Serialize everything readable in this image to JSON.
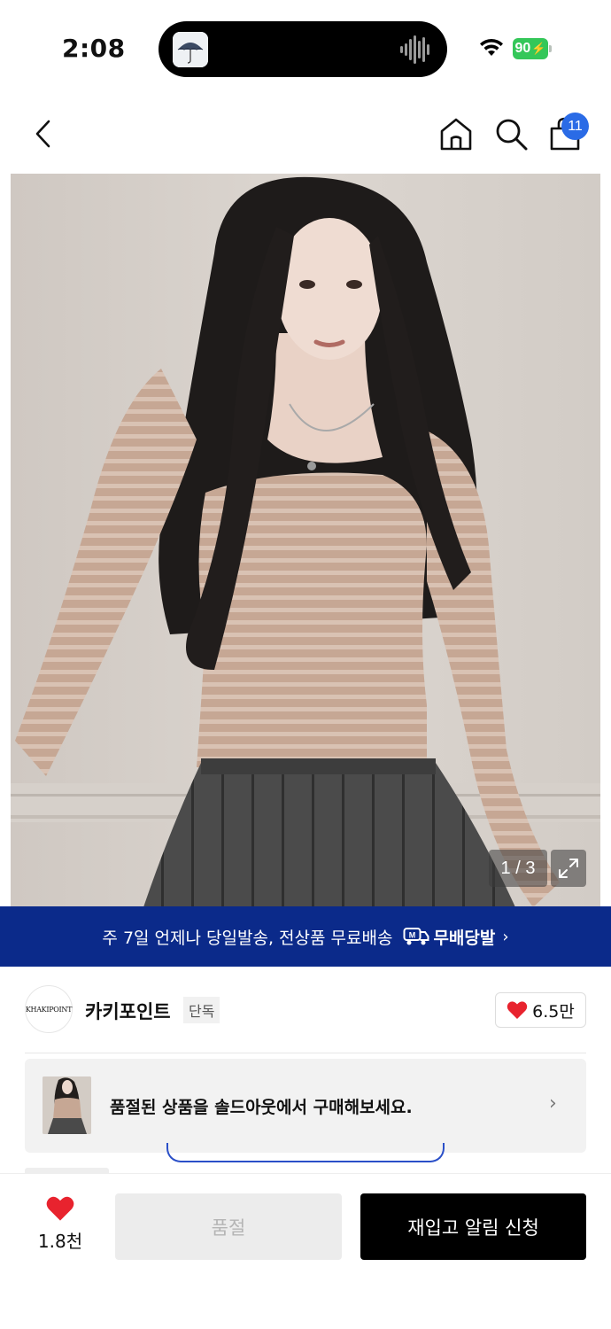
{
  "status_bar": {
    "time": "2:08",
    "battery": "90",
    "icons": [
      "wifi-icon",
      "battery-charging-icon",
      "audio-wave-icon"
    ]
  },
  "nav": {
    "icons": [
      "back-chevron-icon",
      "home-icon",
      "search-icon",
      "shopping-bag-icon"
    ],
    "cart_count": "11"
  },
  "gallery": {
    "counter": "1 / 3",
    "expand_icon": "expand-icon"
  },
  "shipping_banner": {
    "text": "주 7일 언제나 당일발송, 전상품 무료배송",
    "brand_label": "무배당발",
    "brand_icon": "delivery-truck-m-icon",
    "chevron": "›"
  },
  "brand": {
    "logo_text": "KHAKIPOINT",
    "name": "카키포인트",
    "tag": "단독",
    "likes": "6.5만",
    "heart_color": "#e8232e"
  },
  "soldout_card": {
    "text": "품절된 상품을 솔드아웃에서 구매해보세요.",
    "chevron": "›"
  },
  "bottom_bar": {
    "like_count": "1.8천",
    "soldout_label": "품절",
    "restock_label": "재입고 알림 신청"
  },
  "colors": {
    "banner_bg": "#0b2a8a",
    "badge": "#2a6be6",
    "battery": "#34c759",
    "primary_button": "#000000"
  }
}
